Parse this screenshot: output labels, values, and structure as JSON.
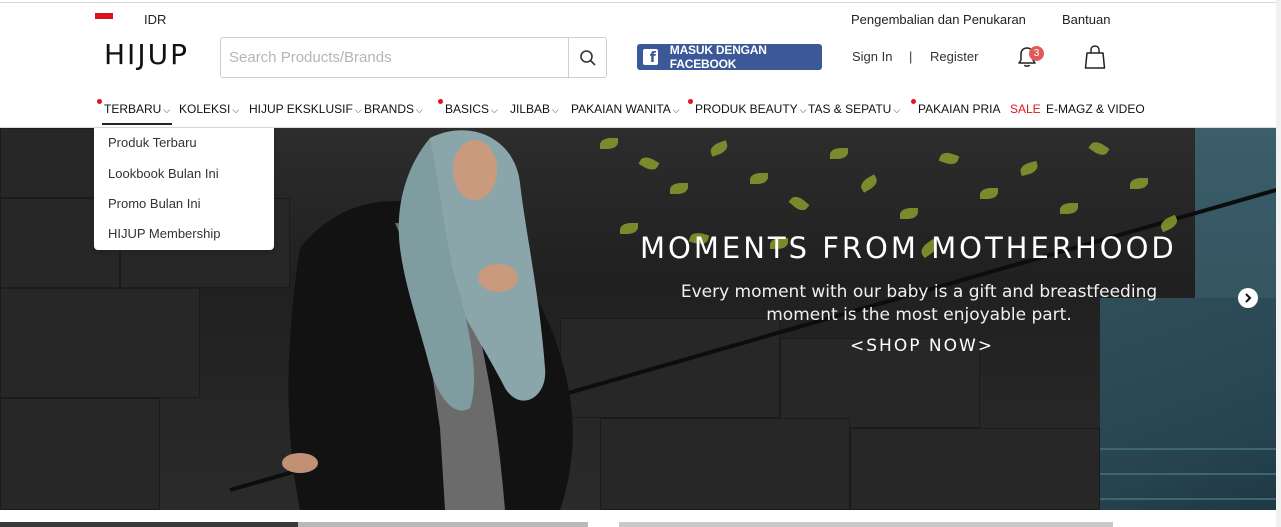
{
  "topbar": {
    "currency": "IDR",
    "returns_link": "Pengembalian dan Penukaran",
    "help_link": "Bantuan"
  },
  "header": {
    "logo": "HIJUP",
    "search_placeholder": "Search Products/Brands",
    "facebook_button": "MASUK DENGAN FACEBOOK",
    "sign_in": "Sign In",
    "separator": "|",
    "register": "Register",
    "notification_count": "3"
  },
  "nav": {
    "items": [
      {
        "label": "TERBARU",
        "dot": true,
        "chevron": true
      },
      {
        "label": "KOLEKSI",
        "dot": false,
        "chevron": true
      },
      {
        "label": "HIJUP EKSKLUSIF",
        "dot": false,
        "chevron": true
      },
      {
        "label": "BRANDS",
        "dot": false,
        "chevron": true
      },
      {
        "label": "BASICS",
        "dot": true,
        "chevron": true
      },
      {
        "label": "JILBAB",
        "dot": false,
        "chevron": true
      },
      {
        "label": "PAKAIAN WANITA",
        "dot": false,
        "chevron": true
      },
      {
        "label": "PRODUK BEAUTY",
        "dot": true,
        "chevron": true
      },
      {
        "label": "TAS & SEPATU",
        "dot": false,
        "chevron": true
      },
      {
        "label": "PAKAIAN PRIA",
        "dot": true,
        "chevron": false
      },
      {
        "label": "SALE",
        "dot": false,
        "chevron": false
      },
      {
        "label": "E-MAGZ & VIDEO",
        "dot": false,
        "chevron": false
      }
    ]
  },
  "dropdown": {
    "items": [
      "Produk Terbaru",
      "Lookbook Bulan Ini",
      "Promo Bulan Ini",
      "HIJUP Membership"
    ]
  },
  "hero": {
    "title": "MOMENTS FROM MOTHERHOOD",
    "subtitle_line1": "Every moment with our baby is a gift and breastfeeding",
    "subtitle_line2": "moment is the most enjoyable part.",
    "cta": "<SHOP NOW>"
  },
  "icons": {
    "search": "search-icon",
    "facebook": "facebook-icon",
    "bell": "bell-icon",
    "bag": "shopping-bag-icon",
    "next": "chevron-right-icon"
  },
  "colors": {
    "facebook": "#3b5998",
    "accent_red": "#e0141e",
    "badge": "#e05a5a"
  }
}
